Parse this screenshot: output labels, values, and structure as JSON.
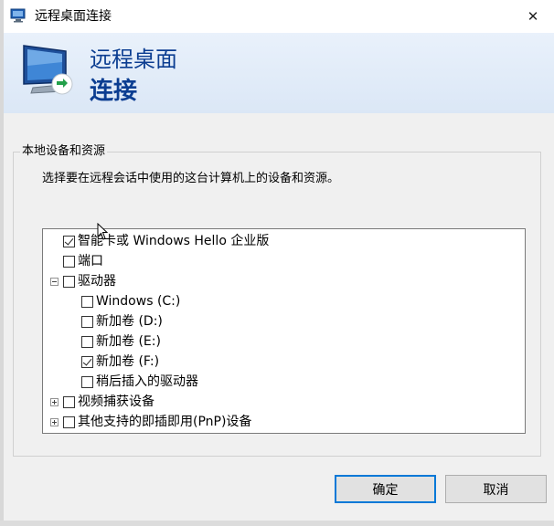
{
  "window": {
    "title": "远程桌面连接",
    "close_symbol": "✕"
  },
  "banner": {
    "line1": "远程桌面",
    "line2": "连接"
  },
  "group": {
    "label": "本地设备和资源",
    "description": "选择要在远程会话中使用的这台计算机上的设备和资源。"
  },
  "tree": {
    "items": [
      {
        "label": "智能卡或 Windows Hello 企业版",
        "checked": true
      },
      {
        "label": "端口",
        "checked": false
      },
      {
        "label": "驱动器",
        "checked": false,
        "expander": "minus"
      },
      {
        "label": "Windows (C:)",
        "checked": false
      },
      {
        "label": "新加卷 (D:)",
        "checked": false
      },
      {
        "label": "新加卷 (E:)",
        "checked": false
      },
      {
        "label": "新加卷 (F:)",
        "checked": true
      },
      {
        "label": "稍后插入的驱动器",
        "checked": false
      },
      {
        "label": "视频捕获设备",
        "checked": false,
        "expander": "plus"
      },
      {
        "label": "其他支持的即插即用(PnP)设备",
        "checked": false,
        "expander": "plus"
      }
    ]
  },
  "buttons": {
    "ok": "确定",
    "cancel": "取消"
  },
  "colors": {
    "accent": "#0078d7",
    "heading": "#0b3d91"
  }
}
